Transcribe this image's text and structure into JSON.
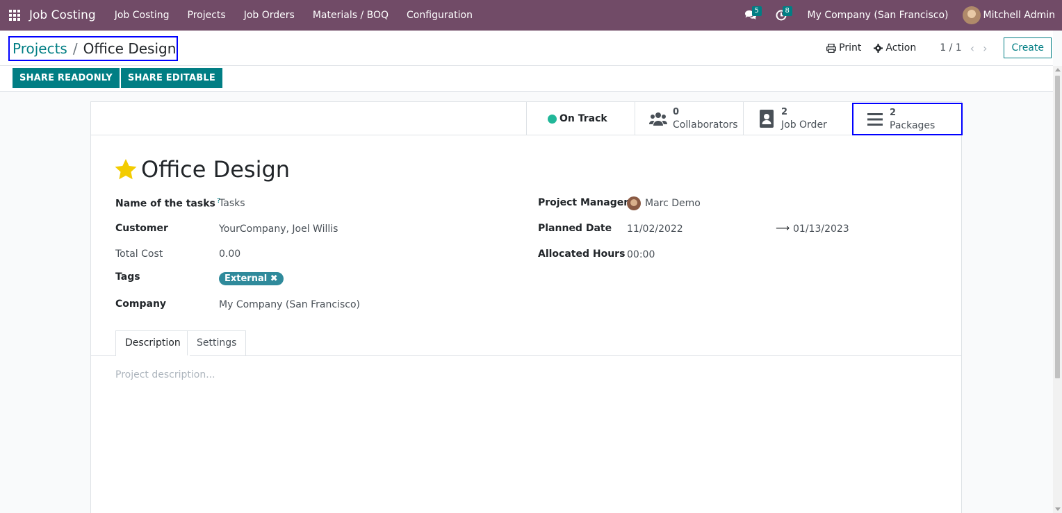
{
  "navbar": {
    "app_name": "Job Costing",
    "menu": [
      "Job Costing",
      "Projects",
      "Job Orders",
      "Materials / BOQ",
      "Configuration"
    ],
    "messages_count": "5",
    "activities_count": "8",
    "company": "My Company (San Francisco)",
    "user": "Mitchell Admin"
  },
  "control_panel": {
    "breadcrumb_parent": "Projects",
    "breadcrumb_separator": "/",
    "breadcrumb_current": "Office Design",
    "print_label": "Print",
    "action_label": "Action",
    "pager": "1 / 1",
    "create_label": "Create",
    "share_readonly_label": "SHARE READONLY",
    "share_editable_label": "SHARE EDITABLE"
  },
  "button_box": {
    "status_label": "On Track",
    "collaborators_value": "0",
    "collaborators_label": "Collaborators",
    "job_order_value": "2",
    "job_order_label": "Job Order",
    "packages_value": "2",
    "packages_label": "Packages"
  },
  "form": {
    "title": "Office Design",
    "left": {
      "tasks_label": "Name of the tasks",
      "tasks_help": "?",
      "tasks_value": "Tasks",
      "customer_label": "Customer",
      "customer_value": "YourCompany, Joel Willis",
      "total_cost_label": "Total Cost",
      "total_cost_value": "0.00",
      "tags_label": "Tags",
      "tag_external": "External",
      "company_label": "Company",
      "company_value": "My Company (San Francisco)"
    },
    "right": {
      "manager_label": "Project Manager",
      "manager_value": "Marc Demo",
      "planned_label": "Planned Date",
      "planned_start": "11/02/2022",
      "planned_end": "01/13/2023",
      "hours_label": "Allocated Hours",
      "hours_value": "00:00"
    },
    "tabs": [
      "Description",
      "Settings"
    ],
    "description_placeholder": "Project description..."
  },
  "colors": {
    "navbar": "#714b67",
    "primary": "#017e84",
    "status_green": "#21b799",
    "star": "#f3cc00",
    "highlight": "#0000ff"
  }
}
